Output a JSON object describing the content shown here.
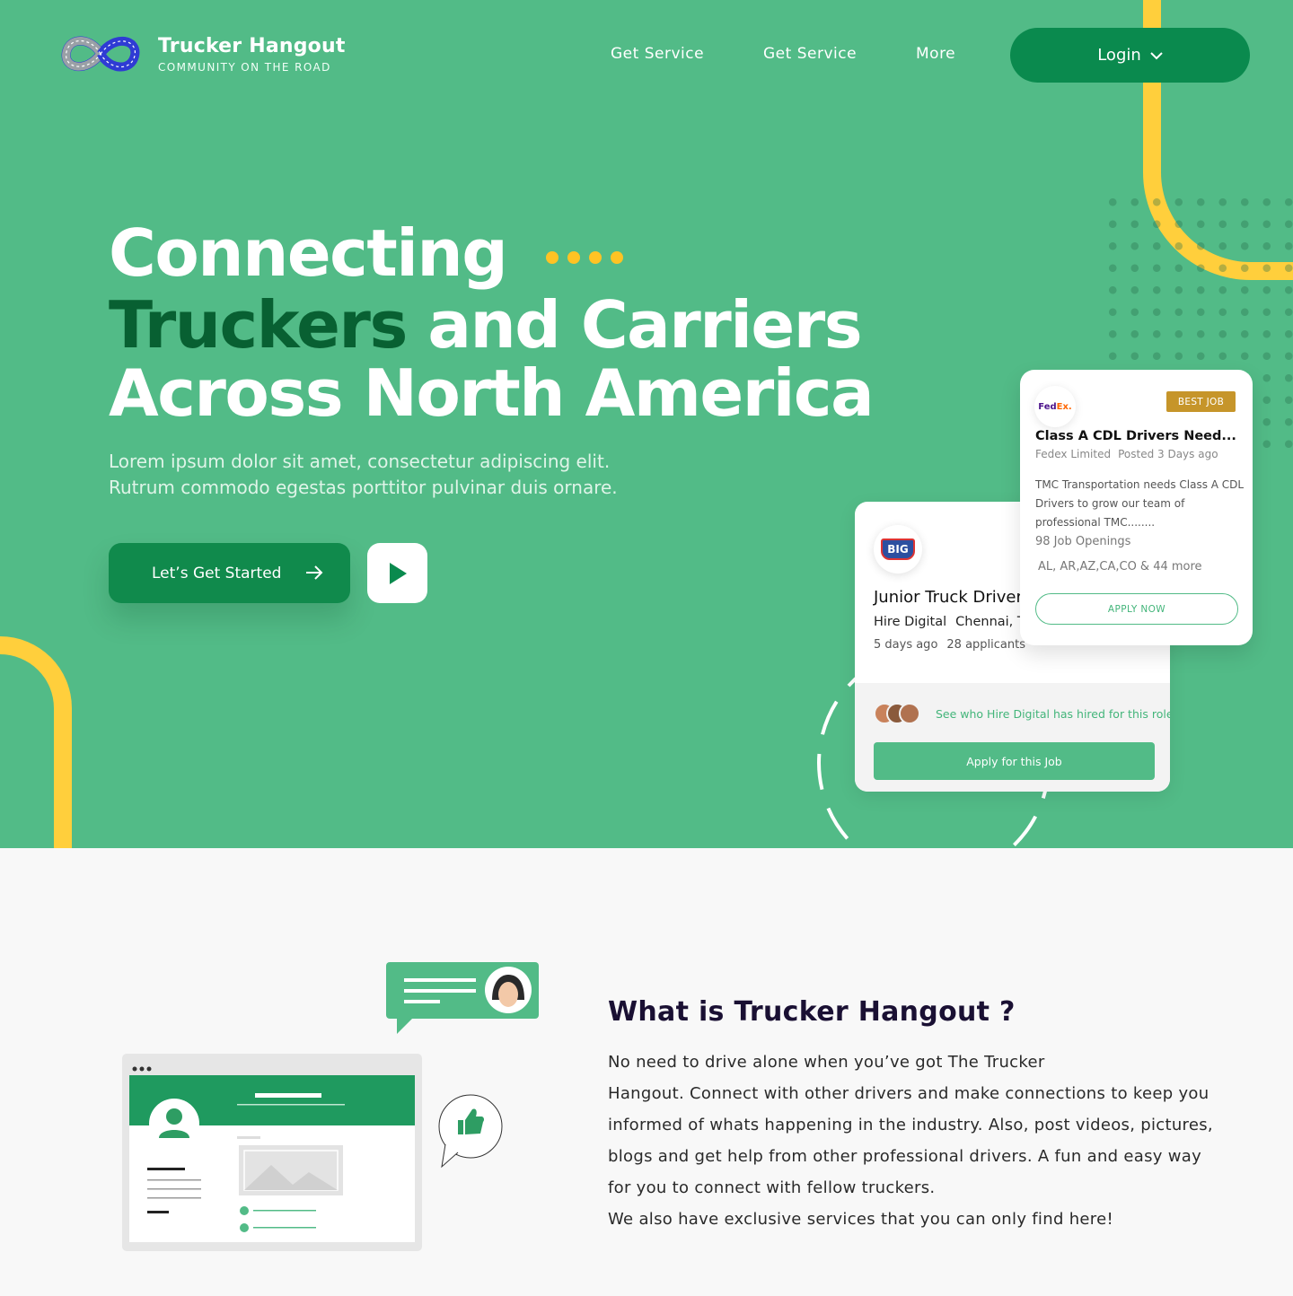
{
  "brand": {
    "title": "Trucker Hangout",
    "subtitle": "COMMUNITY ON THE ROAD"
  },
  "nav": {
    "links": [
      "Get Service",
      "Get Service",
      "More"
    ],
    "login_label": "Login"
  },
  "hero": {
    "line1": "Connecting",
    "line2_highlight": "Truckers",
    "line2_rest": " and Carriers",
    "line3": "Across North America",
    "subtitle_line1": "Lorem ipsum dolor sit amet, consectetur adipiscing elit.",
    "subtitle_line2": "Rutrum commodo egestas porttitor pulvinar duis ornare.",
    "cta_label": "Let’s Get Started"
  },
  "job_card_back": {
    "logo_text": "BIG",
    "title": "Junior Truck Driver",
    "company": "Hire Digital",
    "location": "Chennai, Tamil Nadu",
    "posted": "5 days ago",
    "applicants": "28 applicants",
    "hire_link": "See who Hire Digital has hired for this role",
    "apply_label": "Apply for this Job"
  },
  "job_card_front": {
    "logo_fe": "Fed",
    "logo_ex": "Ex.",
    "badge": "BEST JOB",
    "title": "Class A CDL Drivers Need...",
    "company": "Fedex Limited",
    "posted": "Posted 3 Days ago",
    "description": "TMC Transportation needs Class A CDL Drivers to grow our team of professional TMC........",
    "openings": "98 Job Openings",
    "states": "AL, AR,AZ,CA,CO & 44 more",
    "apply_label": "APPLY NOW"
  },
  "about": {
    "title": "What is Trucker Hangout  ?",
    "p1_line1": "No need to drive alone when you’ve got The Trucker",
    "p1_rest": "Hangout. Connect with other drivers and make connections to keep you informed of whats happening in the industry. Also, post videos, pictures, blogs and get help from other professional drivers. A fun and easy way for you to connect with fellow truckers.",
    "p2": "We also have exclusive services that you can only find here!"
  },
  "colors": {
    "hero_green": "#52bb87",
    "dark_green": "#0a8a4e",
    "accent_yellow": "#ffcf3c",
    "badge_gold": "#c6952a"
  }
}
